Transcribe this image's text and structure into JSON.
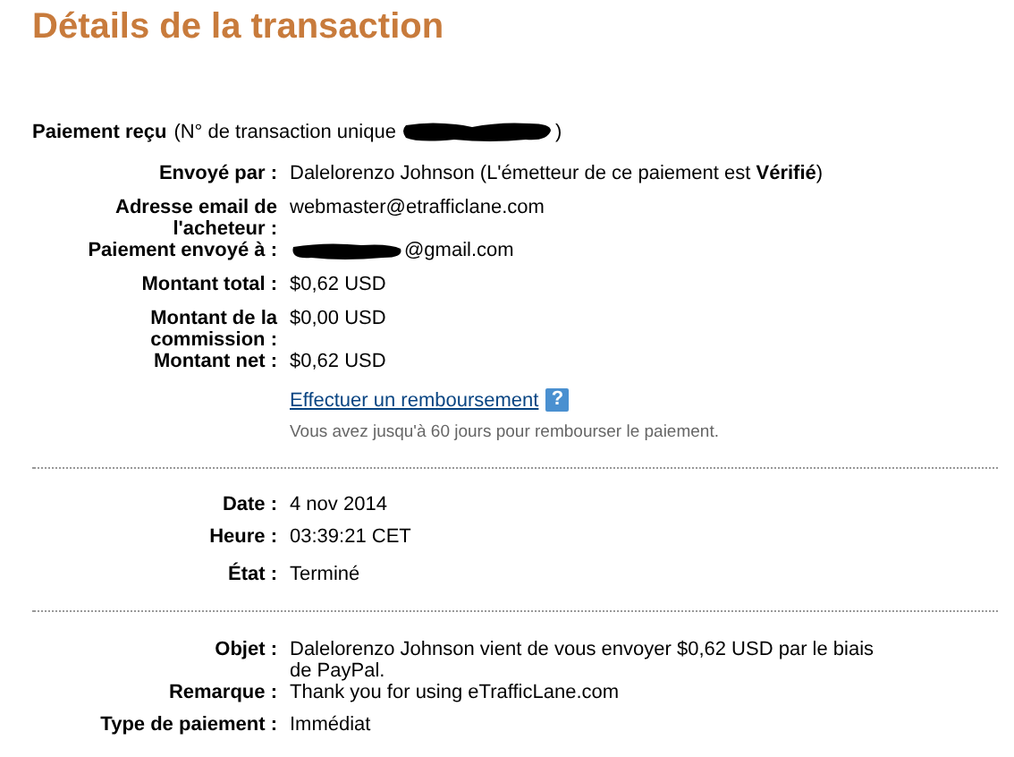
{
  "title": "Détails de la transaction",
  "header": {
    "title": "Paiement reçu",
    "detail_prefix": "(N° de transaction unique",
    "detail_suffix": ")",
    "redacted": true
  },
  "sections": [
    {
      "groups": [
        [
          {
            "label": "Envoyé par :",
            "value": "Dalelorenzo Johnson (L'émetteur de ce paiement est **Vérifié**)"
          }
        ],
        [
          {
            "label": "Adresse email de\nl'acheteur :",
            "value": "webmaster@etrafficlane.com"
          },
          {
            "label": "Paiement envoyé à :",
            "value": "@gmail.com",
            "redacted": true
          }
        ],
        [
          {
            "label": "Montant total :",
            "value": "$0,62 USD"
          }
        ],
        [
          {
            "label": "Montant de la\ncommission :",
            "value": "$0,00 USD"
          },
          {
            "label": "Montant net :",
            "value": "$0,62 USD"
          }
        ]
      ],
      "refund": {
        "link": "Effectuer un remboursement",
        "help_glyph": "?",
        "note": "Vous avez jusqu'à 60 jours pour rembourser le paiement."
      }
    },
    {
      "groups": [
        [
          {
            "label": "Date :",
            "value": "4 nov 2014"
          }
        ],
        [
          {
            "label": "Heure :",
            "value": "03:39:21 CET"
          }
        ],
        [
          {
            "label": "État :",
            "value": "Terminé"
          }
        ]
      ]
    },
    {
      "groups": [
        [
          {
            "label": "Objet :",
            "value": "Dalelorenzo Johnson vient de vous envoyer $0,62 USD par le biais de PayPal."
          },
          {
            "label": "Remarque :",
            "value": "Thank you for using eTrafficLane.com"
          }
        ],
        [
          {
            "label": "Type de paiement :",
            "value": "Immédiat"
          }
        ]
      ]
    }
  ]
}
